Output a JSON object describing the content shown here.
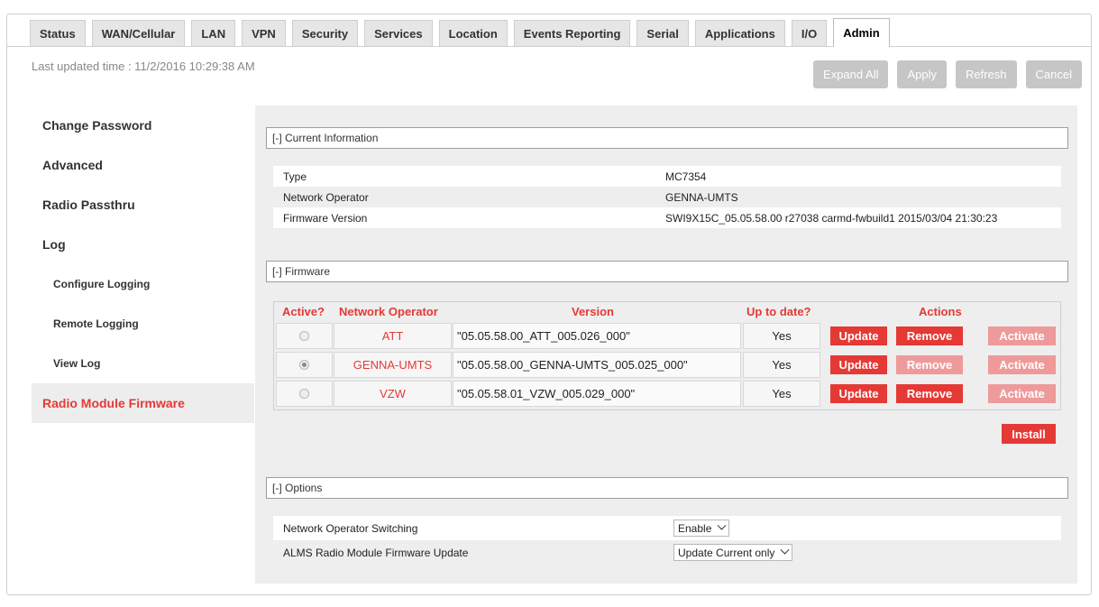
{
  "tabs": [
    {
      "label": "Status",
      "active": false
    },
    {
      "label": "WAN/Cellular",
      "active": false
    },
    {
      "label": "LAN",
      "active": false
    },
    {
      "label": "VPN",
      "active": false
    },
    {
      "label": "Security",
      "active": false
    },
    {
      "label": "Services",
      "active": false
    },
    {
      "label": "Location",
      "active": false
    },
    {
      "label": "Events Reporting",
      "active": false
    },
    {
      "label": "Serial",
      "active": false
    },
    {
      "label": "Applications",
      "active": false
    },
    {
      "label": "I/O",
      "active": false
    },
    {
      "label": "Admin",
      "active": true
    }
  ],
  "last_updated": "Last updated time : 11/2/2016 10:29:38 AM",
  "buttons": {
    "expand_all": "Expand All",
    "apply": "Apply",
    "refresh": "Refresh",
    "cancel": "Cancel",
    "install": "Install"
  },
  "sidebar": {
    "items": [
      {
        "label": "Change Password"
      },
      {
        "label": "Advanced"
      },
      {
        "label": "Radio Passthru"
      },
      {
        "label": "Log"
      },
      {
        "label": "Configure Logging"
      },
      {
        "label": "Remote Logging"
      },
      {
        "label": "View Log"
      },
      {
        "label": "Radio Module Firmware"
      }
    ]
  },
  "current_info": {
    "header": "[-] Current Information",
    "rows": [
      {
        "key": "Type",
        "value": "MC7354"
      },
      {
        "key": "Network Operator",
        "value": "GENNA-UMTS"
      },
      {
        "key": "Firmware Version",
        "value": "SWI9X15C_05.05.58.00 r27038 carmd-fwbuild1 2015/03/04 21:30:23"
      }
    ]
  },
  "firmware": {
    "header": "[-] Firmware",
    "columns": {
      "active": "Active?",
      "operator": "Network Operator",
      "version": "Version",
      "up_to_date": "Up to date?",
      "actions": "Actions"
    },
    "action_labels": {
      "update": "Update",
      "remove": "Remove",
      "activate": "Activate"
    },
    "rows": [
      {
        "operator": "ATT",
        "version": "\"05.05.58.00_ATT_005.026_000\"",
        "up_to_date": "Yes",
        "active": false,
        "remove_enabled": true,
        "activate_enabled": false
      },
      {
        "operator": "GENNA-UMTS",
        "version": "\"05.05.58.00_GENNA-UMTS_005.025_000\"",
        "up_to_date": "Yes",
        "active": true,
        "remove_enabled": false,
        "activate_enabled": false
      },
      {
        "operator": "VZW",
        "version": "\"05.05.58.01_VZW_005.029_000\"",
        "up_to_date": "Yes",
        "active": false,
        "remove_enabled": true,
        "activate_enabled": false
      }
    ]
  },
  "options": {
    "header": "[-] Options",
    "rows": [
      {
        "key": "Network Operator Switching",
        "value": "Enable"
      },
      {
        "key": "ALMS Radio Module Firmware Update",
        "value": "Update Current only"
      }
    ]
  },
  "colors": {
    "accent": "#e53935",
    "accent_disabled": "#ef9a9a",
    "button_gray": "#c6c6c6",
    "panel_bg": "#eeeeee"
  }
}
